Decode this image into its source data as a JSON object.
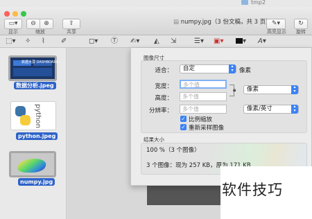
{
  "background_window": {
    "title": "tmp2"
  },
  "window": {
    "title": "numpy.jpg（3 份文稿，共 3 页）"
  },
  "toolbar": {
    "display_label": "显示",
    "zoom_label": "缩放",
    "share_label": "共享",
    "highlight_label": "高亮显示",
    "rotate_label": "旋转"
  },
  "sidebar": {
    "items": [
      {
        "label": "数据分析.jpeg",
        "thumb_text": "数据大屏 DASHBOARD"
      },
      {
        "label": "python.jpeg",
        "thumb_text": "python"
      },
      {
        "label": "numpy.jpg"
      }
    ]
  },
  "adjust_size": {
    "section_title": "图像尺寸",
    "fit_label": "适合：",
    "fit_value": "自定",
    "fit_unit": "像素",
    "width_label": "宽度：",
    "width_placeholder": "多个值",
    "height_label": "高度：",
    "height_placeholder": "多个值",
    "unit_value": "像素",
    "resolution_label": "分辨率：",
    "resolution_placeholder": "多个值",
    "resolution_unit": "像素/英寸",
    "scale_proportionally": "比例缩放",
    "resample": "重新采样图像",
    "result_title": "结果大小",
    "result_percent": "100 %（3 个图像）",
    "result_summary": "3 个图像：现为 257 KB，原为 171 KB"
  },
  "watermark": {
    "text": "软件技巧"
  },
  "colors": {
    "accent": "#3b82f5",
    "selection": "#2f63c8"
  }
}
